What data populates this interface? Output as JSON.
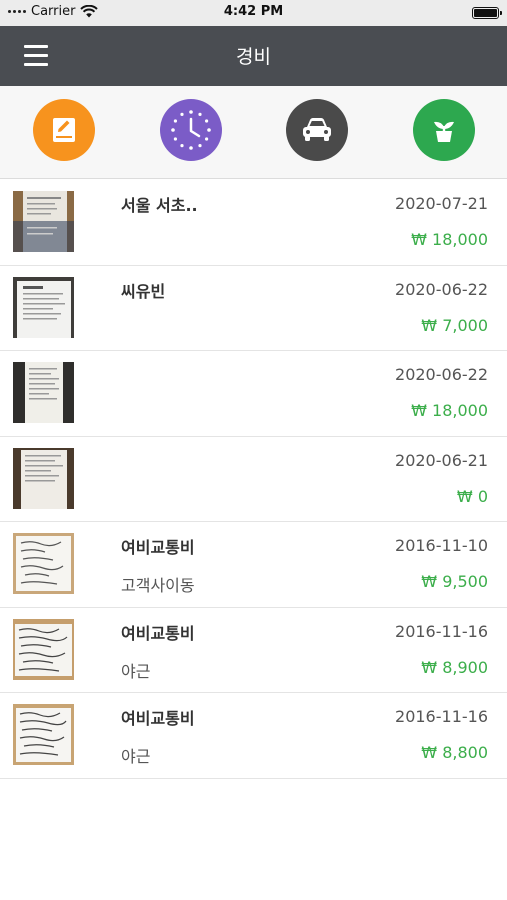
{
  "status_bar": {
    "carrier": "Carrier",
    "time": "4:42 PM"
  },
  "nav": {
    "title": "경비"
  },
  "categories": [
    {
      "name": "edit-note-icon",
      "color": "#f7931e"
    },
    {
      "name": "clock-icon",
      "color": "#7b5cc7"
    },
    {
      "name": "car-icon",
      "color": "#4a4a4a"
    },
    {
      "name": "plant-icon",
      "color": "#2da84f"
    }
  ],
  "colors": {
    "amount": "#3cae4b",
    "nav_bg": "#4a4d52"
  },
  "expenses": [
    {
      "title": "서울 서초..",
      "subtitle": "",
      "date": "2020-07-21",
      "amount": "₩ 18,000"
    },
    {
      "title": "씨유빈",
      "subtitle": "",
      "date": "2020-06-22",
      "amount": "₩ 7,000"
    },
    {
      "title": "",
      "subtitle": "",
      "date": "2020-06-22",
      "amount": "₩ 18,000"
    },
    {
      "title": "",
      "subtitle": "",
      "date": "2020-06-21",
      "amount": "₩ 0"
    },
    {
      "title": "여비교통비",
      "subtitle": "고객사이동",
      "date": "2016-11-10",
      "amount": "₩ 9,500"
    },
    {
      "title": "여비교통비",
      "subtitle": "야근",
      "date": "2016-11-16",
      "amount": "₩ 8,900"
    },
    {
      "title": "여비교통비",
      "subtitle": "야근",
      "date": "2016-11-16",
      "amount": "₩ 8,800"
    }
  ]
}
